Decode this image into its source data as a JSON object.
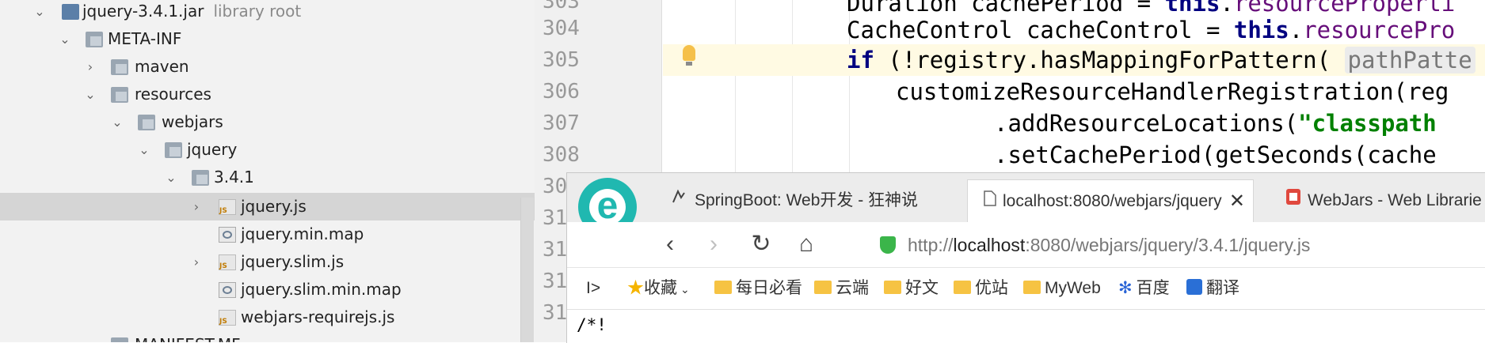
{
  "project_tree": {
    "items": [
      {
        "label": "jquery-3.4.1.jar",
        "sub": "library root",
        "expanded": true,
        "icon": "jar-icon"
      },
      {
        "label": "META-INF",
        "expanded": true,
        "icon": "folder-icon"
      },
      {
        "label": "maven",
        "expanded": false,
        "icon": "folder-icon"
      },
      {
        "label": "resources",
        "expanded": true,
        "icon": "folder-icon"
      },
      {
        "label": "webjars",
        "expanded": true,
        "icon": "folder-icon"
      },
      {
        "label": "jquery",
        "expanded": true,
        "icon": "folder-icon"
      },
      {
        "label": "3.4.1",
        "expanded": true,
        "icon": "folder-icon"
      },
      {
        "label": "jquery.js",
        "expanded": false,
        "icon": "js-file-icon",
        "selected": true
      },
      {
        "label": "jquery.min.map",
        "icon": "map-file-icon"
      },
      {
        "label": "jquery.slim.js",
        "expanded": false,
        "icon": "js-file-icon"
      },
      {
        "label": "jquery.slim.min.map",
        "icon": "map-file-icon"
      },
      {
        "label": "webjars-requirejs.js",
        "icon": "js-file-icon"
      },
      {
        "label": "MANIFEST.MF",
        "icon": "file-icon"
      }
    ]
  },
  "editor": {
    "line_numbers": [
      "303",
      "304",
      "305",
      "306",
      "307",
      "308",
      "30",
      "31",
      "31",
      "31",
      "31"
    ],
    "lines": [
      {
        "p1": "Duration cachePeriod = ",
        "kw": "this",
        "p2": ".",
        "fld": "resourceProperti"
      },
      {
        "p1": "CacheControl cacheControl = ",
        "kw": "this",
        "p2": ".",
        "fld": "resourcePro"
      },
      {
        "kw": "if",
        "p1": " (!registry.hasMappingForPattern( ",
        "hint": "pathPatte"
      },
      {
        "p1": "customizeResourceHandlerRegistration(reg"
      },
      {
        "p1": ".addResourceLocations(",
        "str": "\"classpath"
      },
      {
        "p1": ".setCachePeriod(getSeconds(cache"
      }
    ]
  },
  "browser": {
    "logo_letter": "e",
    "tabs": [
      {
        "label": "SpringBoot: Web开发 - 狂神说",
        "icon": "springboot-tab-icon"
      },
      {
        "label": "localhost:8080/webjars/jquery",
        "icon": "page-icon",
        "close": "✕",
        "active": true
      },
      {
        "label": "WebJars - Web Librarie",
        "icon": "webjars-icon"
      }
    ],
    "nav": {
      "back": "‹",
      "forward": "›",
      "refresh": "↻",
      "home": "⌂"
    },
    "address": {
      "prefix": "http://",
      "host": "localhost",
      "rest": ":8080/webjars/jquery/3.4.1/jquery.js"
    },
    "bookmarks": {
      "toggle": "I>",
      "favorites": "收藏",
      "items": [
        "每日必看",
        "云端",
        "好文",
        "优站",
        "MyWeb",
        "百度",
        "翻译"
      ]
    },
    "page_text": "/*!"
  },
  "colors": {
    "tree_bg": "#f2f2f2",
    "selected_row": "#d5d5d5",
    "keyword": "#000080",
    "field": "#660e7a",
    "string": "#008000",
    "logo": "#20b8b0"
  }
}
